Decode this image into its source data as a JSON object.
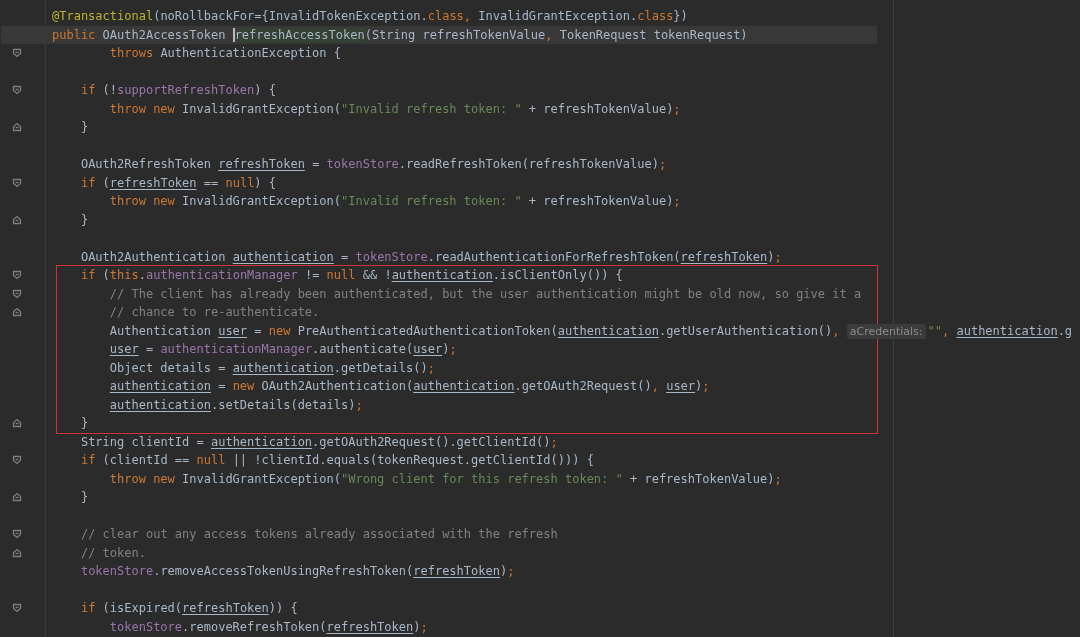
{
  "editor": {
    "blocks": [
      {
        "highlighted": false,
        "lines": [
          {
            "kind": "code",
            "fold_start": false,
            "fold_end": false,
            "current": false,
            "segments": [
              {
                "text": "@Transactional",
                "kind": "annotation"
              },
              {
                "text": "(noRollbackFor={InvalidTokenException.",
                "kind": "plain"
              },
              {
                "text": "class",
                "kind": "keyword"
              },
              {
                "text": ", ",
                "kind": "punct"
              },
              {
                "text": "InvalidGrantException.",
                "kind": "plain"
              },
              {
                "text": "class",
                "kind": "keyword"
              },
              {
                "text": "})",
                "kind": "plain"
              }
            ]
          },
          {
            "kind": "code",
            "fold_start": false,
            "fold_end": false,
            "current": true,
            "segments": [
              {
                "text": "public ",
                "kind": "keyword"
              },
              {
                "text": "OAuth2AccessToken ",
                "kind": "plain"
              },
              {
                "text": "refreshAccessToken",
                "kind": "match"
              },
              {
                "text": "(String refreshTokenValue",
                "kind": "plain"
              },
              {
                "text": ", ",
                "kind": "punct"
              },
              {
                "text": "TokenRequest tokenRequest)",
                "kind": "plain"
              }
            ]
          },
          {
            "kind": "code",
            "fold_start": true,
            "fold_end": false,
            "current": false,
            "segments": [
              {
                "text": "        throws ",
                "kind": "keyword"
              },
              {
                "text": "AuthenticationException {",
                "kind": "plain"
              }
            ]
          },
          {
            "kind": "blank",
            "fold_start": false,
            "fold_end": false,
            "current": false
          },
          {
            "kind": "code",
            "fold_start": true,
            "fold_end": false,
            "current": false,
            "segments": [
              {
                "text": "    if ",
                "kind": "keyword"
              },
              {
                "text": "(!",
                "kind": "plain"
              },
              {
                "text": "supportRefreshToken",
                "kind": "field"
              },
              {
                "text": ") {",
                "kind": "plain"
              }
            ]
          },
          {
            "kind": "code",
            "fold_start": false,
            "fold_end": false,
            "current": false,
            "segments": [
              {
                "text": "        throw new ",
                "kind": "keyword"
              },
              {
                "text": "InvalidGrantException(",
                "kind": "plain"
              },
              {
                "text": "\"Invalid refresh token: \"",
                "kind": "string"
              },
              {
                "text": " + refreshTokenValue)",
                "kind": "plain"
              },
              {
                "text": ";",
                "kind": "punct"
              }
            ]
          },
          {
            "kind": "code",
            "fold_start": false,
            "fold_end": true,
            "current": false,
            "segments": [
              {
                "text": "    }",
                "kind": "plain"
              }
            ]
          },
          {
            "kind": "blank",
            "fold_start": false,
            "fold_end": false,
            "current": false
          },
          {
            "kind": "code",
            "fold_start": false,
            "fold_end": false,
            "current": false,
            "segments": [
              {
                "text": "    OAuth2RefreshToken ",
                "kind": "plain"
              },
              {
                "text": "refreshToken",
                "kind": "var"
              },
              {
                "text": " = ",
                "kind": "plain"
              },
              {
                "text": "tokenStore",
                "kind": "field"
              },
              {
                "text": ".readRefreshToken(refreshTokenValue)",
                "kind": "plain"
              },
              {
                "text": ";",
                "kind": "punct"
              }
            ]
          },
          {
            "kind": "code",
            "fold_start": true,
            "fold_end": false,
            "current": false,
            "segments": [
              {
                "text": "    if ",
                "kind": "keyword"
              },
              {
                "text": "(",
                "kind": "plain"
              },
              {
                "text": "refreshToken",
                "kind": "var"
              },
              {
                "text": " == ",
                "kind": "plain"
              },
              {
                "text": "null",
                "kind": "keyword"
              },
              {
                "text": ") {",
                "kind": "plain"
              }
            ]
          },
          {
            "kind": "code",
            "fold_start": false,
            "fold_end": false,
            "current": false,
            "segments": [
              {
                "text": "        throw new ",
                "kind": "keyword"
              },
              {
                "text": "InvalidGrantException(",
                "kind": "plain"
              },
              {
                "text": "\"Invalid refresh token: \"",
                "kind": "string"
              },
              {
                "text": " + refreshTokenValue)",
                "kind": "plain"
              },
              {
                "text": ";",
                "kind": "punct"
              }
            ]
          },
          {
            "kind": "code",
            "fold_start": false,
            "fold_end": true,
            "current": false,
            "segments": [
              {
                "text": "    }",
                "kind": "plain"
              }
            ]
          },
          {
            "kind": "blank",
            "fold_start": false,
            "fold_end": false,
            "current": false
          },
          {
            "kind": "code",
            "fold_start": false,
            "fold_end": false,
            "current": false,
            "segments": [
              {
                "text": "    OAuth2Authentication ",
                "kind": "plain"
              },
              {
                "text": "authentication",
                "kind": "var"
              },
              {
                "text": " = ",
                "kind": "plain"
              },
              {
                "text": "tokenStore",
                "kind": "field"
              },
              {
                "text": ".readAuthenticationForRefreshToken(",
                "kind": "plain"
              },
              {
                "text": "refreshToken",
                "kind": "var"
              },
              {
                "text": ")",
                "kind": "plain"
              },
              {
                "text": ";",
                "kind": "punct"
              }
            ]
          }
        ]
      },
      {
        "highlighted": true,
        "lines": [
          {
            "kind": "code",
            "fold_start": true,
            "fold_end": false,
            "current": false,
            "segments": [
              {
                "text": "    if ",
                "kind": "keyword"
              },
              {
                "text": "(",
                "kind": "plain"
              },
              {
                "text": "this",
                "kind": "keyword"
              },
              {
                "text": ".",
                "kind": "plain"
              },
              {
                "text": "authenticationManager",
                "kind": "field"
              },
              {
                "text": " != ",
                "kind": "plain"
              },
              {
                "text": "null ",
                "kind": "keyword"
              },
              {
                "text": "&& !",
                "kind": "plain"
              },
              {
                "text": "authentication",
                "kind": "var"
              },
              {
                "text": ".isClientOnly()) {",
                "kind": "plain"
              }
            ]
          },
          {
            "kind": "code",
            "fold_start": true,
            "fold_end": false,
            "current": false,
            "segments": [
              {
                "text": "        // The client has already been authenticated, but the user authentication might be old now, so give it a",
                "kind": "comment"
              }
            ]
          },
          {
            "kind": "code",
            "fold_start": false,
            "fold_end": true,
            "current": false,
            "segments": [
              {
                "text": "        // chance to re-authenticate.",
                "kind": "comment"
              }
            ]
          },
          {
            "kind": "code",
            "fold_start": false,
            "fold_end": false,
            "current": false,
            "segments": [
              {
                "text": "        Authentication ",
                "kind": "plain"
              },
              {
                "text": "user",
                "kind": "var"
              },
              {
                "text": " = ",
                "kind": "plain"
              },
              {
                "text": "new ",
                "kind": "keyword"
              },
              {
                "text": "PreAuthenticatedAuthenticationToken(",
                "kind": "plain"
              },
              {
                "text": "authentication",
                "kind": "var"
              },
              {
                "text": ".getUserAuthentication()",
                "kind": "plain"
              },
              {
                "text": ", ",
                "kind": "punct"
              },
              {
                "text": "aCredentials:",
                "kind": "hint"
              },
              {
                "text": "\"\"",
                "kind": "string"
              },
              {
                "text": ", ",
                "kind": "punct"
              },
              {
                "text": "authentication",
                "kind": "var"
              },
              {
                "text": ".g",
                "kind": "plain"
              }
            ]
          },
          {
            "kind": "code",
            "fold_start": false,
            "fold_end": false,
            "current": false,
            "segments": [
              {
                "text": "        user",
                "kind": "var"
              },
              {
                "text": " = ",
                "kind": "plain"
              },
              {
                "text": "authenticationManager",
                "kind": "field"
              },
              {
                "text": ".authenticate(",
                "kind": "plain"
              },
              {
                "text": "user",
                "kind": "var"
              },
              {
                "text": ")",
                "kind": "plain"
              },
              {
                "text": ";",
                "kind": "punct"
              }
            ]
          },
          {
            "kind": "code",
            "fold_start": false,
            "fold_end": false,
            "current": false,
            "segments": [
              {
                "text": "        Object details = ",
                "kind": "plain"
              },
              {
                "text": "authentication",
                "kind": "var"
              },
              {
                "text": ".getDetails()",
                "kind": "plain"
              },
              {
                "text": ";",
                "kind": "punct"
              }
            ]
          },
          {
            "kind": "code",
            "fold_start": false,
            "fold_end": false,
            "current": false,
            "segments": [
              {
                "text": "        authentication",
                "kind": "var"
              },
              {
                "text": " = ",
                "kind": "plain"
              },
              {
                "text": "new ",
                "kind": "keyword"
              },
              {
                "text": "OAuth2Authentication(",
                "kind": "plain"
              },
              {
                "text": "authentication",
                "kind": "var"
              },
              {
                "text": ".getOAuth2Request()",
                "kind": "plain"
              },
              {
                "text": ", ",
                "kind": "punct"
              },
              {
                "text": "user",
                "kind": "var"
              },
              {
                "text": ")",
                "kind": "plain"
              },
              {
                "text": ";",
                "kind": "punct"
              }
            ]
          },
          {
            "kind": "code",
            "fold_start": false,
            "fold_end": false,
            "current": false,
            "segments": [
              {
                "text": "        authentication",
                "kind": "var"
              },
              {
                "text": ".setDetails(details)",
                "kind": "plain"
              },
              {
                "text": ";",
                "kind": "punct"
              }
            ]
          },
          {
            "kind": "code",
            "fold_start": false,
            "fold_end": true,
            "current": false,
            "segments": [
              {
                "text": "    }",
                "kind": "plain"
              }
            ]
          }
        ]
      },
      {
        "highlighted": false,
        "lines": [
          {
            "kind": "code",
            "fold_start": false,
            "fold_end": false,
            "current": false,
            "segments": [
              {
                "text": "    String clientId = ",
                "kind": "plain"
              },
              {
                "text": "authentication",
                "kind": "var"
              },
              {
                "text": ".getOAuth2Request().getClientId()",
                "kind": "plain"
              },
              {
                "text": ";",
                "kind": "punct"
              }
            ]
          },
          {
            "kind": "code",
            "fold_start": true,
            "fold_end": false,
            "current": false,
            "segments": [
              {
                "text": "    if ",
                "kind": "keyword"
              },
              {
                "text": "(clientId == ",
                "kind": "plain"
              },
              {
                "text": "null ",
                "kind": "keyword"
              },
              {
                "text": "|| !clientId.equals(tokenRequest.getClientId())) {",
                "kind": "plain"
              }
            ]
          },
          {
            "kind": "code",
            "fold_start": false,
            "fold_end": false,
            "current": false,
            "segments": [
              {
                "text": "        throw new ",
                "kind": "keyword"
              },
              {
                "text": "InvalidGrantException(",
                "kind": "plain"
              },
              {
                "text": "\"Wrong client for this refresh token: \"",
                "kind": "string"
              },
              {
                "text": " + refreshTokenValue)",
                "kind": "plain"
              },
              {
                "text": ";",
                "kind": "punct"
              }
            ]
          },
          {
            "kind": "code",
            "fold_start": false,
            "fold_end": true,
            "current": false,
            "segments": [
              {
                "text": "    }",
                "kind": "plain"
              }
            ]
          },
          {
            "kind": "blank",
            "fold_start": false,
            "fold_end": false,
            "current": false
          },
          {
            "kind": "code",
            "fold_start": true,
            "fold_end": false,
            "current": false,
            "segments": [
              {
                "text": "    // clear out any access tokens already associated with the refresh",
                "kind": "comment"
              }
            ]
          },
          {
            "kind": "code",
            "fold_start": false,
            "fold_end": true,
            "current": false,
            "segments": [
              {
                "text": "    // token.",
                "kind": "comment"
              }
            ]
          },
          {
            "kind": "code",
            "fold_start": false,
            "fold_end": false,
            "current": false,
            "segments": [
              {
                "text": "    tokenStore",
                "kind": "field"
              },
              {
                "text": ".removeAccessTokenUsingRefreshToken(",
                "kind": "plain"
              },
              {
                "text": "refreshToken",
                "kind": "var"
              },
              {
                "text": ")",
                "kind": "plain"
              },
              {
                "text": ";",
                "kind": "punct"
              }
            ]
          },
          {
            "kind": "blank",
            "fold_start": false,
            "fold_end": false,
            "current": false
          },
          {
            "kind": "code",
            "fold_start": true,
            "fold_end": false,
            "current": false,
            "segments": [
              {
                "text": "    if ",
                "kind": "keyword"
              },
              {
                "text": "(isExpired(",
                "kind": "plain"
              },
              {
                "text": "refreshToken",
                "kind": "var"
              },
              {
                "text": ")) {",
                "kind": "plain"
              }
            ]
          },
          {
            "kind": "code",
            "fold_start": false,
            "fold_end": false,
            "current": false,
            "segments": [
              {
                "text": "        tokenStore",
                "kind": "field"
              },
              {
                "text": ".removeRefreshToken(",
                "kind": "plain"
              },
              {
                "text": "refreshToken",
                "kind": "var"
              },
              {
                "text": ")",
                "kind": "plain"
              },
              {
                "text": ";",
                "kind": "punct"
              }
            ]
          }
        ]
      }
    ]
  }
}
